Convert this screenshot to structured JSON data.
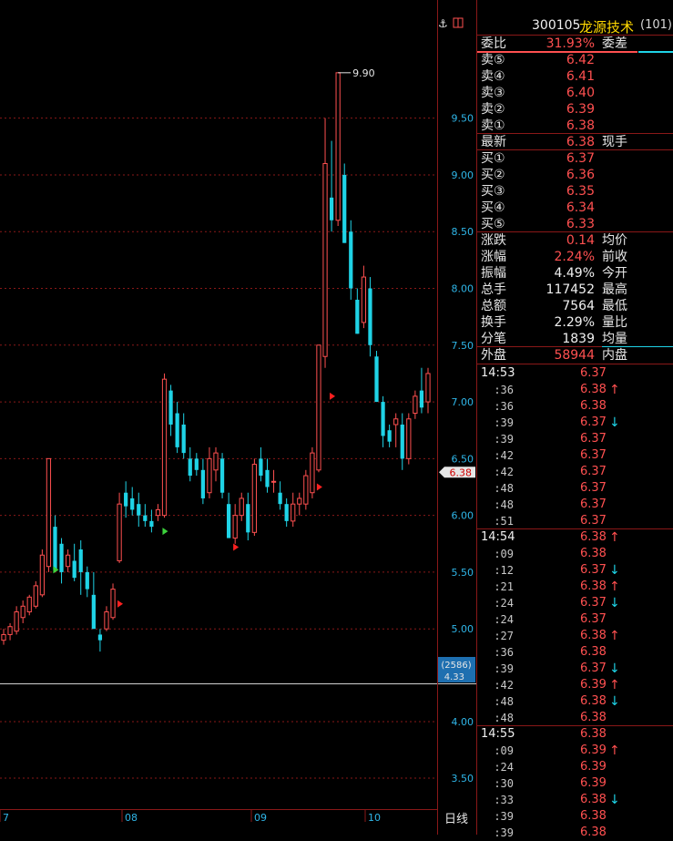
{
  "stock": {
    "code": "300105",
    "name": "龙源技术",
    "market": "(101)"
  },
  "quote": {
    "weibi_label": "委比",
    "weibi_value": "31.93%",
    "weicha_label": "委差",
    "sell": [
      {
        "label": "卖⑤",
        "price": "6.42"
      },
      {
        "label": "卖④",
        "price": "6.41"
      },
      {
        "label": "卖③",
        "price": "6.40"
      },
      {
        "label": "卖②",
        "price": "6.39"
      },
      {
        "label": "卖①",
        "price": "6.38"
      }
    ],
    "latest_label": "最新",
    "latest_value": "6.38",
    "xianshou_label": "现手",
    "buy": [
      {
        "label": "买①",
        "price": "6.37"
      },
      {
        "label": "买②",
        "price": "6.36"
      },
      {
        "label": "买③",
        "price": "6.35"
      },
      {
        "label": "买④",
        "price": "6.34"
      },
      {
        "label": "买⑤",
        "price": "6.33"
      }
    ],
    "stats": [
      {
        "label": "涨跌",
        "value": "0.14",
        "color": "#ff5050",
        "label2": "均价"
      },
      {
        "label": "涨幅",
        "value": "2.24%",
        "color": "#ff5050",
        "label2": "前收"
      },
      {
        "label": "振幅",
        "value": "4.49%",
        "color": "#f0f0f0",
        "label2": "今开"
      },
      {
        "label": "总手",
        "value": "117452",
        "color": "#f0f0f0",
        "label2": "最高"
      },
      {
        "label": "总额",
        "value": "7564",
        "color": "#f0f0f0",
        "label2": "最低"
      },
      {
        "label": "换手",
        "value": "2.29%",
        "color": "#f0f0f0",
        "label2": "量比"
      },
      {
        "label": "分笔",
        "value": "1839",
        "color": "#f0f0f0",
        "label2": "均量"
      }
    ],
    "waipan_label": "外盘",
    "waipan_value": "58944",
    "neipan_label": "内盘"
  },
  "ticks": [
    {
      "time": "14:53",
      "price": "6.37",
      "dir": ""
    },
    {
      "time": ":36",
      "price": "6.38",
      "dir": "up"
    },
    {
      "time": ":36",
      "price": "6.38",
      "dir": ""
    },
    {
      "time": ":39",
      "price": "6.37",
      "dir": "down"
    },
    {
      "time": ":39",
      "price": "6.37",
      "dir": ""
    },
    {
      "time": ":42",
      "price": "6.37",
      "dir": ""
    },
    {
      "time": ":42",
      "price": "6.37",
      "dir": ""
    },
    {
      "time": ":48",
      "price": "6.37",
      "dir": ""
    },
    {
      "time": ":48",
      "price": "6.37",
      "dir": ""
    },
    {
      "time": ":51",
      "price": "6.37",
      "dir": ""
    },
    {
      "time": "14:54",
      "price": "6.38",
      "dir": "up"
    },
    {
      "time": ":09",
      "price": "6.38",
      "dir": ""
    },
    {
      "time": ":12",
      "price": "6.37",
      "dir": "down"
    },
    {
      "time": ":21",
      "price": "6.38",
      "dir": "up"
    },
    {
      "time": ":24",
      "price": "6.37",
      "dir": "down"
    },
    {
      "time": ":24",
      "price": "6.37",
      "dir": ""
    },
    {
      "time": ":27",
      "price": "6.38",
      "dir": "up"
    },
    {
      "time": ":36",
      "price": "6.38",
      "dir": ""
    },
    {
      "time": ":39",
      "price": "6.37",
      "dir": "down"
    },
    {
      "time": ":42",
      "price": "6.39",
      "dir": "up"
    },
    {
      "time": ":48",
      "price": "6.38",
      "dir": "down"
    },
    {
      "time": ":48",
      "price": "6.38",
      "dir": ""
    },
    {
      "time": "14:55",
      "price": "6.38",
      "dir": ""
    },
    {
      "time": ":09",
      "price": "6.39",
      "dir": "up"
    },
    {
      "time": ":24",
      "price": "6.39",
      "dir": ""
    },
    {
      "time": ":30",
      "price": "6.39",
      "dir": ""
    },
    {
      "time": ":33",
      "price": "6.38",
      "dir": "down"
    },
    {
      "time": ":39",
      "price": "6.38",
      "dir": ""
    },
    {
      "time": ":39",
      "price": "6.38",
      "dir": ""
    }
  ],
  "arrows": {
    "up": "↑",
    "down": "↓"
  },
  "chart_data": {
    "type": "candlestick",
    "y_ticks": [
      "9.50",
      "9.00",
      "8.50",
      "8.00",
      "7.50",
      "7.00",
      "6.50",
      "6.00",
      "5.50",
      "5.00"
    ],
    "lower_y_ticks": [
      "4.00",
      "3.50"
    ],
    "x_labels": [
      "7",
      "08",
      "09",
      "10"
    ],
    "period_label": "日线",
    "high_label": "9.90",
    "current_price_label": "6.38",
    "volume_box": {
      "line1": "(2586)",
      "line2": "4.33"
    },
    "ylim": [
      4.52,
      10.3
    ],
    "colors": {
      "up": "#ff5050",
      "down": "#1fd3e6",
      "grid": "#8a1818"
    },
    "candles": [
      [
        4.9,
        5.0,
        4.86,
        4.95
      ],
      [
        4.95,
        5.05,
        4.9,
        5.02
      ],
      [
        4.98,
        5.2,
        4.95,
        5.15
      ],
      [
        5.1,
        5.25,
        5.05,
        5.2
      ],
      [
        5.15,
        5.3,
        5.12,
        5.28
      ],
      [
        5.2,
        5.42,
        5.18,
        5.38
      ],
      [
        5.3,
        5.7,
        5.28,
        5.65
      ],
      [
        5.55,
        6.5,
        5.5,
        6.5
      ],
      [
        5.9,
        6.0,
        5.5,
        5.52
      ],
      [
        5.75,
        5.8,
        5.4,
        5.5
      ],
      [
        5.55,
        5.7,
        5.5,
        5.65
      ],
      [
        5.6,
        5.75,
        5.42,
        5.45
      ],
      [
        5.7,
        5.78,
        5.3,
        5.5
      ],
      [
        5.5,
        5.55,
        5.28,
        5.35
      ],
      [
        5.3,
        5.5,
        5.0,
        5.0
      ],
      [
        4.95,
        5.0,
        4.8,
        4.9
      ],
      [
        5.0,
        5.2,
        4.98,
        5.15
      ],
      [
        5.1,
        5.4,
        5.08,
        5.35
      ],
      [
        5.6,
        6.2,
        5.58,
        6.1
      ],
      [
        6.2,
        6.3,
        5.98,
        6.08
      ],
      [
        6.15,
        6.25,
        6.0,
        6.05
      ],
      [
        6.1,
        6.2,
        5.9,
        6.0
      ],
      [
        6.0,
        6.1,
        5.9,
        5.95
      ],
      [
        5.95,
        6.05,
        5.85,
        5.9
      ],
      [
        6.0,
        6.1,
        5.95,
        6.05
      ],
      [
        6.0,
        7.25,
        5.98,
        7.2
      ],
      [
        7.1,
        7.15,
        6.7,
        6.8
      ],
      [
        6.9,
        7.0,
        6.55,
        6.6
      ],
      [
        6.8,
        6.9,
        6.5,
        6.55
      ],
      [
        6.5,
        6.6,
        6.3,
        6.35
      ],
      [
        6.5,
        6.55,
        6.35,
        6.4
      ],
      [
        6.4,
        6.5,
        6.1,
        6.15
      ],
      [
        6.2,
        6.6,
        6.15,
        6.5
      ],
      [
        6.4,
        6.6,
        6.3,
        6.55
      ],
      [
        6.5,
        6.55,
        6.15,
        6.2
      ],
      [
        6.1,
        6.2,
        5.8,
        5.8
      ],
      [
        5.8,
        6.1,
        5.75,
        6.0
      ],
      [
        6.0,
        6.2,
        5.95,
        6.15
      ],
      [
        6.1,
        6.2,
        5.78,
        5.85
      ],
      [
        5.85,
        6.5,
        5.82,
        6.45
      ],
      [
        6.5,
        6.6,
        6.3,
        6.35
      ],
      [
        6.4,
        6.5,
        6.2,
        6.25
      ],
      [
        6.3,
        6.4,
        6.2,
        6.3
      ],
      [
        6.2,
        6.3,
        6.05,
        6.1
      ],
      [
        6.1,
        6.15,
        5.9,
        5.95
      ],
      [
        5.95,
        6.2,
        5.9,
        6.1
      ],
      [
        6.1,
        6.2,
        6.0,
        6.15
      ],
      [
        6.1,
        6.4,
        6.05,
        6.35
      ],
      [
        6.2,
        6.6,
        6.15,
        6.55
      ],
      [
        6.4,
        7.5,
        6.38,
        7.5
      ],
      [
        7.4,
        9.5,
        7.3,
        9.1
      ],
      [
        8.8,
        9.3,
        8.5,
        8.6
      ],
      [
        8.6,
        9.9,
        8.55,
        9.9
      ],
      [
        9.0,
        9.1,
        8.4,
        8.4
      ],
      [
        8.5,
        8.6,
        7.9,
        8.0
      ],
      [
        7.9,
        8.0,
        7.6,
        7.6
      ],
      [
        7.7,
        8.2,
        7.65,
        8.1
      ],
      [
        8.0,
        8.1,
        7.4,
        7.5
      ],
      [
        7.4,
        7.45,
        7.0,
        7.0
      ],
      [
        7.0,
        7.05,
        6.6,
        6.7
      ],
      [
        6.75,
        6.8,
        6.6,
        6.65
      ],
      [
        6.8,
        6.9,
        6.6,
        6.85
      ],
      [
        6.8,
        6.9,
        6.4,
        6.5
      ],
      [
        6.5,
        6.9,
        6.45,
        6.85
      ],
      [
        6.9,
        7.1,
        6.85,
        7.05
      ],
      [
        7.1,
        7.3,
        6.9,
        6.95
      ],
      [
        7.0,
        7.3,
        6.9,
        7.25
      ]
    ]
  }
}
